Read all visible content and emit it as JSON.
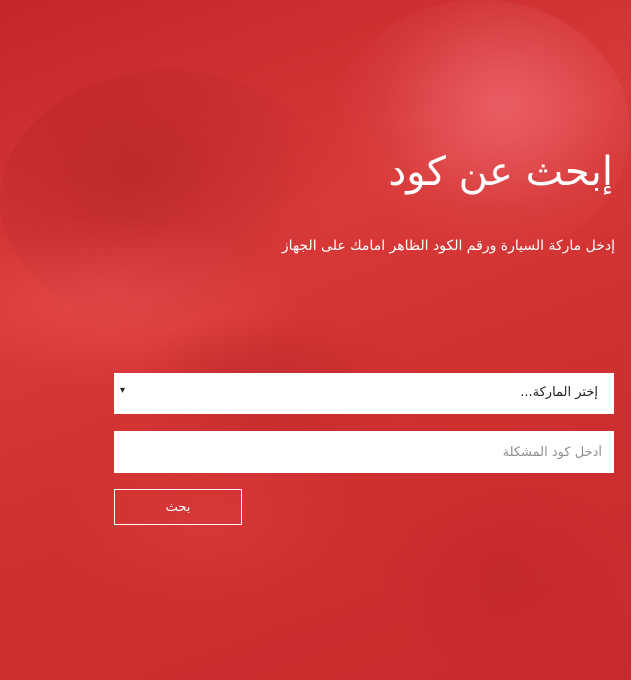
{
  "hero": {
    "title": "إبحث عن كود",
    "subtitle": "إدخل ماركة السيارة ورقم الكود الظاهر امامك على الجهاز"
  },
  "form": {
    "brand_select": {
      "selected_value": "إختر الماركة...",
      "arrow_glyph": "▾"
    },
    "code_input": {
      "value": "",
      "placeholder": "أدخل كود المشكلة"
    },
    "search_button_label": "بحث"
  },
  "colors": {
    "background": "#d12f2f",
    "text": "#ffffff",
    "field_background": "#ffffff",
    "placeholder": "#8f8f8f"
  }
}
